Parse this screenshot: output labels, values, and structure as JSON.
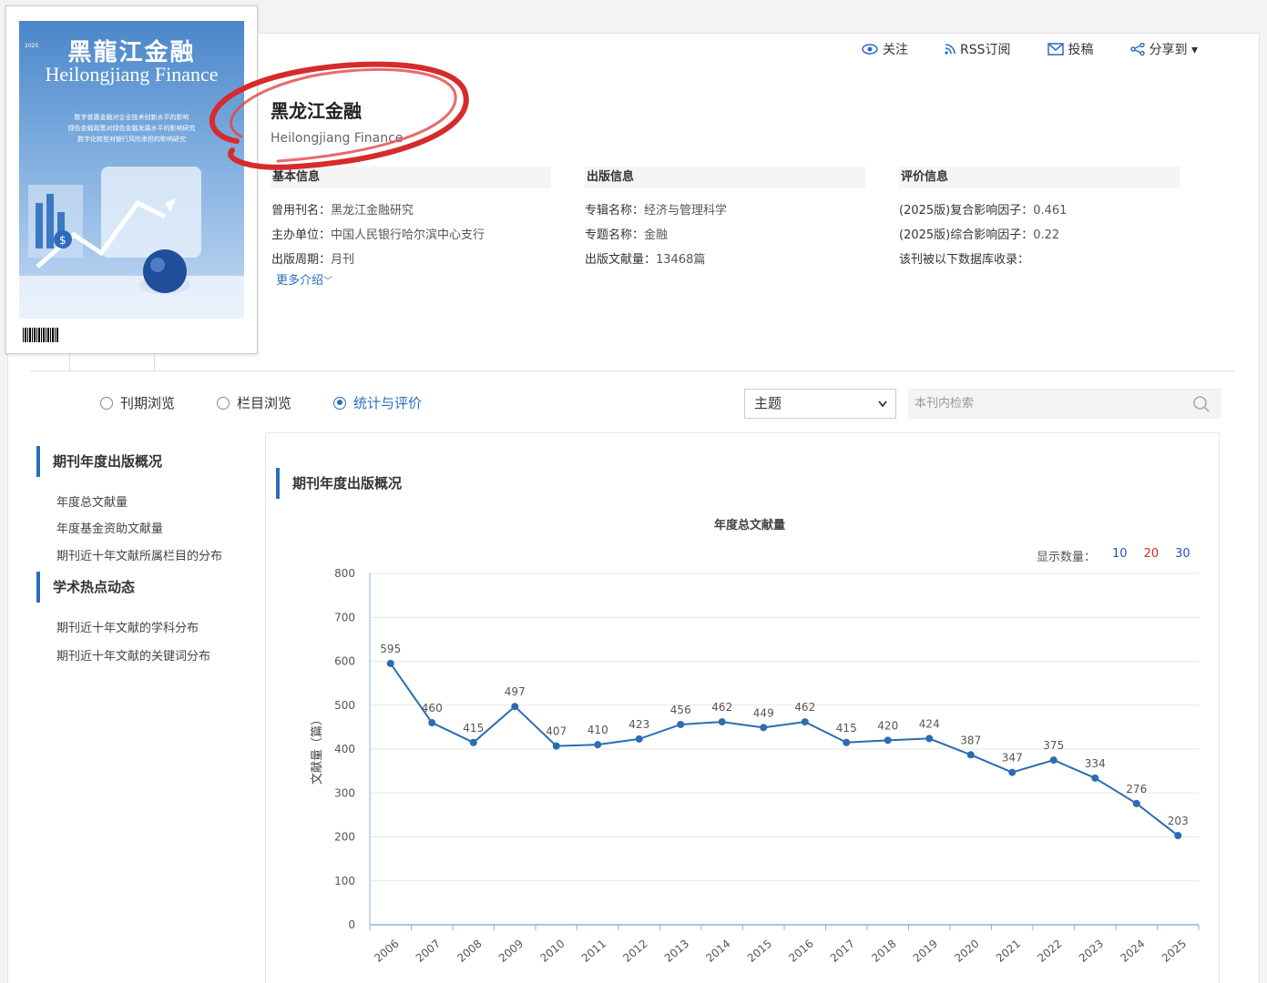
{
  "actions": [
    {
      "icon": "eye-icon",
      "label": "关注"
    },
    {
      "icon": "rss-icon",
      "label": "RSS订阅"
    },
    {
      "icon": "mail-icon",
      "label": "投稿"
    },
    {
      "icon": "share-icon",
      "label": "分享到 ▾"
    }
  ],
  "cover": {
    "title_cn": "黑龍江金融",
    "title_en": "Heilongjiang Finance",
    "lines": [
      "数字普惠金融对企业技术创新水平的影响",
      "绿色金融政策对绿色金融发展水平的影响研究",
      "数字化转型对银行风险承担的影响研究"
    ]
  },
  "journal": {
    "title": "黑龙江金融",
    "title_en": "Heilongjiang Finance"
  },
  "basic_info": {
    "heading": "基本信息",
    "rows": [
      {
        "k": "曾用刊名：",
        "v": "黑龙江金融研究"
      },
      {
        "k": "主办单位：",
        "v": "中国人民银行哈尔滨中心支行"
      },
      {
        "k": "出版周期：",
        "v": "月刊"
      }
    ],
    "more": "更多介绍"
  },
  "pub_info": {
    "heading": "出版信息",
    "rows": [
      {
        "k": "专辑名称：",
        "v": "经济与管理科学"
      },
      {
        "k": "专题名称：",
        "v": "金融"
      },
      {
        "k": "出版文献量：",
        "v": "13468篇"
      }
    ]
  },
  "eval_info": {
    "heading": "评价信息",
    "rows": [
      {
        "k": "(2025版)复合影响因子：",
        "v": "0.461"
      },
      {
        "k": "(2025版)综合影响因子：",
        "v": "0.22"
      },
      {
        "k": "该刊被以下数据库收录：",
        "v": ""
      }
    ]
  },
  "tabs": [
    {
      "label": "刊期浏览",
      "active": false
    },
    {
      "label": "栏目浏览",
      "active": false
    },
    {
      "label": "统计与评价",
      "active": true
    }
  ],
  "search": {
    "select_value": "主题",
    "placeholder": "本刊内检索"
  },
  "sidebar": {
    "sections": [
      {
        "title": "期刊年度出版概况",
        "items": [
          "年度总文献量",
          "年度基金资助文献量",
          "期刊近十年文献所属栏目的分布"
        ]
      },
      {
        "title": "学术热点动态",
        "items": [
          "期刊近十年文献的学科分布",
          "期刊近十年文献的关键词分布"
        ]
      }
    ]
  },
  "panel": {
    "heading": "期刊年度出版概况",
    "show_label": "显示数量：",
    "show_options": [
      "10",
      "20",
      "30"
    ],
    "show_colors": [
      "#2a4fbf",
      "#d42a2a",
      "#2a4fbf"
    ]
  },
  "chart_data": {
    "type": "line",
    "title": "年度总文献量",
    "ylabel": "文献量（篇）",
    "xlabel": "",
    "ylim": [
      0,
      800
    ],
    "yticks": [
      0,
      100,
      200,
      300,
      400,
      500,
      600,
      700,
      800
    ],
    "grid": true,
    "color": "#2a6db0",
    "x": [
      "2006",
      "2007",
      "2008",
      "2009",
      "2010",
      "2011",
      "2012",
      "2013",
      "2014",
      "2015",
      "2016",
      "2017",
      "2018",
      "2019",
      "2020",
      "2021",
      "2022",
      "2023",
      "2024",
      "2025"
    ],
    "values": [
      595,
      460,
      415,
      497,
      407,
      410,
      423,
      456,
      462,
      449,
      462,
      415,
      420,
      424,
      387,
      347,
      375,
      334,
      276,
      203
    ]
  }
}
